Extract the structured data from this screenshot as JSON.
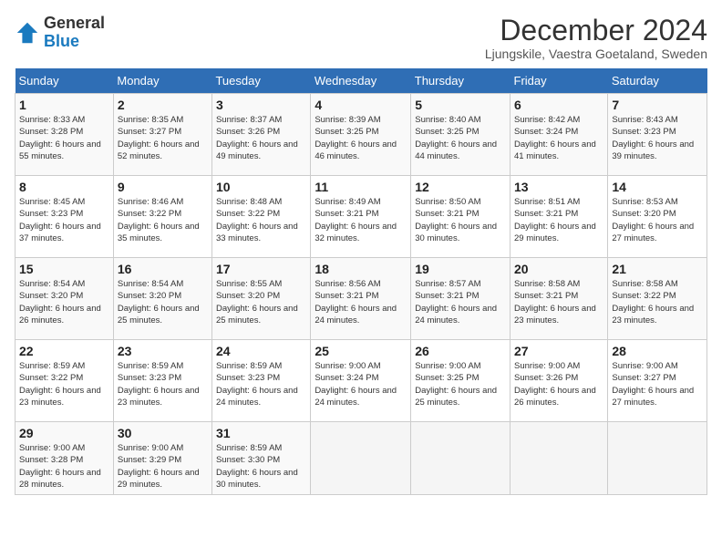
{
  "logo": {
    "general": "General",
    "blue": "Blue"
  },
  "title": "December 2024",
  "subtitle": "Ljungskile, Vaestra Goetaland, Sweden",
  "days_of_week": [
    "Sunday",
    "Monday",
    "Tuesday",
    "Wednesday",
    "Thursday",
    "Friday",
    "Saturday"
  ],
  "weeks": [
    [
      {
        "day": "1",
        "sunrise": "Sunrise: 8:33 AM",
        "sunset": "Sunset: 3:28 PM",
        "daylight": "Daylight: 6 hours and 55 minutes."
      },
      {
        "day": "2",
        "sunrise": "Sunrise: 8:35 AM",
        "sunset": "Sunset: 3:27 PM",
        "daylight": "Daylight: 6 hours and 52 minutes."
      },
      {
        "day": "3",
        "sunrise": "Sunrise: 8:37 AM",
        "sunset": "Sunset: 3:26 PM",
        "daylight": "Daylight: 6 hours and 49 minutes."
      },
      {
        "day": "4",
        "sunrise": "Sunrise: 8:39 AM",
        "sunset": "Sunset: 3:25 PM",
        "daylight": "Daylight: 6 hours and 46 minutes."
      },
      {
        "day": "5",
        "sunrise": "Sunrise: 8:40 AM",
        "sunset": "Sunset: 3:25 PM",
        "daylight": "Daylight: 6 hours and 44 minutes."
      },
      {
        "day": "6",
        "sunrise": "Sunrise: 8:42 AM",
        "sunset": "Sunset: 3:24 PM",
        "daylight": "Daylight: 6 hours and 41 minutes."
      },
      {
        "day": "7",
        "sunrise": "Sunrise: 8:43 AM",
        "sunset": "Sunset: 3:23 PM",
        "daylight": "Daylight: 6 hours and 39 minutes."
      }
    ],
    [
      {
        "day": "8",
        "sunrise": "Sunrise: 8:45 AM",
        "sunset": "Sunset: 3:23 PM",
        "daylight": "Daylight: 6 hours and 37 minutes."
      },
      {
        "day": "9",
        "sunrise": "Sunrise: 8:46 AM",
        "sunset": "Sunset: 3:22 PM",
        "daylight": "Daylight: 6 hours and 35 minutes."
      },
      {
        "day": "10",
        "sunrise": "Sunrise: 8:48 AM",
        "sunset": "Sunset: 3:22 PM",
        "daylight": "Daylight: 6 hours and 33 minutes."
      },
      {
        "day": "11",
        "sunrise": "Sunrise: 8:49 AM",
        "sunset": "Sunset: 3:21 PM",
        "daylight": "Daylight: 6 hours and 32 minutes."
      },
      {
        "day": "12",
        "sunrise": "Sunrise: 8:50 AM",
        "sunset": "Sunset: 3:21 PM",
        "daylight": "Daylight: 6 hours and 30 minutes."
      },
      {
        "day": "13",
        "sunrise": "Sunrise: 8:51 AM",
        "sunset": "Sunset: 3:21 PM",
        "daylight": "Daylight: 6 hours and 29 minutes."
      },
      {
        "day": "14",
        "sunrise": "Sunrise: 8:53 AM",
        "sunset": "Sunset: 3:20 PM",
        "daylight": "Daylight: 6 hours and 27 minutes."
      }
    ],
    [
      {
        "day": "15",
        "sunrise": "Sunrise: 8:54 AM",
        "sunset": "Sunset: 3:20 PM",
        "daylight": "Daylight: 6 hours and 26 minutes."
      },
      {
        "day": "16",
        "sunrise": "Sunrise: 8:54 AM",
        "sunset": "Sunset: 3:20 PM",
        "daylight": "Daylight: 6 hours and 25 minutes."
      },
      {
        "day": "17",
        "sunrise": "Sunrise: 8:55 AM",
        "sunset": "Sunset: 3:20 PM",
        "daylight": "Daylight: 6 hours and 25 minutes."
      },
      {
        "day": "18",
        "sunrise": "Sunrise: 8:56 AM",
        "sunset": "Sunset: 3:21 PM",
        "daylight": "Daylight: 6 hours and 24 minutes."
      },
      {
        "day": "19",
        "sunrise": "Sunrise: 8:57 AM",
        "sunset": "Sunset: 3:21 PM",
        "daylight": "Daylight: 6 hours and 24 minutes."
      },
      {
        "day": "20",
        "sunrise": "Sunrise: 8:58 AM",
        "sunset": "Sunset: 3:21 PM",
        "daylight": "Daylight: 6 hours and 23 minutes."
      },
      {
        "day": "21",
        "sunrise": "Sunrise: 8:58 AM",
        "sunset": "Sunset: 3:22 PM",
        "daylight": "Daylight: 6 hours and 23 minutes."
      }
    ],
    [
      {
        "day": "22",
        "sunrise": "Sunrise: 8:59 AM",
        "sunset": "Sunset: 3:22 PM",
        "daylight": "Daylight: 6 hours and 23 minutes."
      },
      {
        "day": "23",
        "sunrise": "Sunrise: 8:59 AM",
        "sunset": "Sunset: 3:23 PM",
        "daylight": "Daylight: 6 hours and 23 minutes."
      },
      {
        "day": "24",
        "sunrise": "Sunrise: 8:59 AM",
        "sunset": "Sunset: 3:23 PM",
        "daylight": "Daylight: 6 hours and 24 minutes."
      },
      {
        "day": "25",
        "sunrise": "Sunrise: 9:00 AM",
        "sunset": "Sunset: 3:24 PM",
        "daylight": "Daylight: 6 hours and 24 minutes."
      },
      {
        "day": "26",
        "sunrise": "Sunrise: 9:00 AM",
        "sunset": "Sunset: 3:25 PM",
        "daylight": "Daylight: 6 hours and 25 minutes."
      },
      {
        "day": "27",
        "sunrise": "Sunrise: 9:00 AM",
        "sunset": "Sunset: 3:26 PM",
        "daylight": "Daylight: 6 hours and 26 minutes."
      },
      {
        "day": "28",
        "sunrise": "Sunrise: 9:00 AM",
        "sunset": "Sunset: 3:27 PM",
        "daylight": "Daylight: 6 hours and 27 minutes."
      }
    ],
    [
      {
        "day": "29",
        "sunrise": "Sunrise: 9:00 AM",
        "sunset": "Sunset: 3:28 PM",
        "daylight": "Daylight: 6 hours and 28 minutes."
      },
      {
        "day": "30",
        "sunrise": "Sunrise: 9:00 AM",
        "sunset": "Sunset: 3:29 PM",
        "daylight": "Daylight: 6 hours and 29 minutes."
      },
      {
        "day": "31",
        "sunrise": "Sunrise: 8:59 AM",
        "sunset": "Sunset: 3:30 PM",
        "daylight": "Daylight: 6 hours and 30 minutes."
      },
      null,
      null,
      null,
      null
    ]
  ]
}
